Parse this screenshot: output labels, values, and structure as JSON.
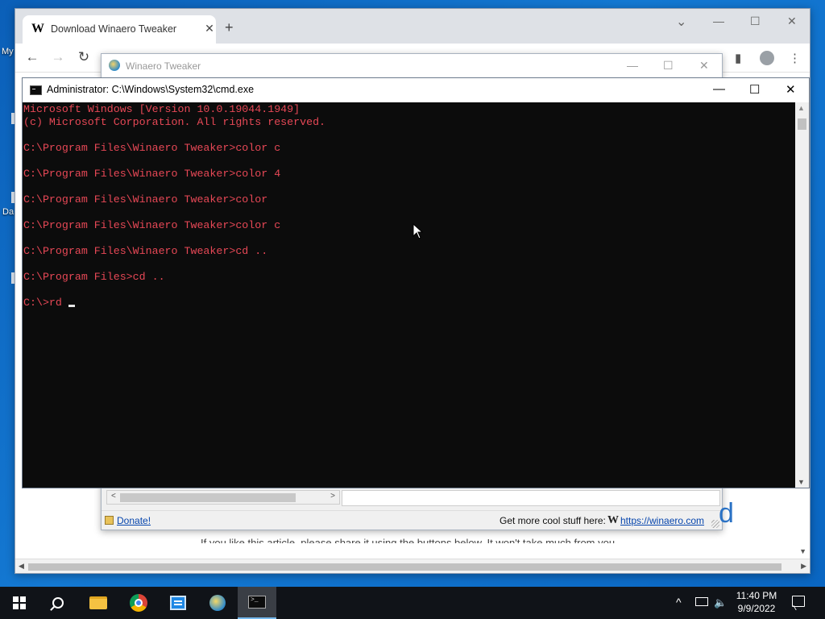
{
  "desktop": {
    "label_1": "My",
    "label_2": "Da"
  },
  "chrome": {
    "tab_title": "Download Winaero Tweaker",
    "tab_favicon": "W",
    "tab_close": "✕",
    "new_tab": "+",
    "back": "←",
    "forward": "→",
    "reload": "↻",
    "min": "—",
    "max": "☐",
    "close": "✕",
    "chevron": "⌄",
    "page_fragment": "If you like this article, please share it using the buttons below. It won't take much from you."
  },
  "tweaker": {
    "title": "Winaero Tweaker",
    "donate": "Donate!",
    "more_text": "Get more cool stuff here:",
    "w_logo": "W",
    "link": "https://winaero.com",
    "scroll_left": "<",
    "scroll_right": ">",
    "min": "—",
    "max": "☐",
    "close": "✕"
  },
  "cmd": {
    "title": "Administrator: C:\\Windows\\System32\\cmd.exe",
    "output": "Microsoft Windows [Version 10.0.19044.1949]\n(c) Microsoft Corporation. All rights reserved.\n\nC:\\Program Files\\Winaero Tweaker>color c\n\nC:\\Program Files\\Winaero Tweaker>color 4\n\nC:\\Program Files\\Winaero Tweaker>color\n\nC:\\Program Files\\Winaero Tweaker>color c\n\nC:\\Program Files\\Winaero Tweaker>cd ..\n\nC:\\Program Files>cd ..\n\n",
    "current_prompt": "C:\\>rd ",
    "text_color": "#e74856",
    "min": "—",
    "max": "☐",
    "close": "✕"
  },
  "taskbar": {
    "icons": [
      "start-icon",
      "search-icon",
      "file-explorer-icon",
      "chrome-icon",
      "app-icon",
      "winaero-tweaker-icon",
      "cmd-icon"
    ],
    "tray_chevron": "^",
    "time": "11:40 PM",
    "date": "9/9/2022"
  }
}
